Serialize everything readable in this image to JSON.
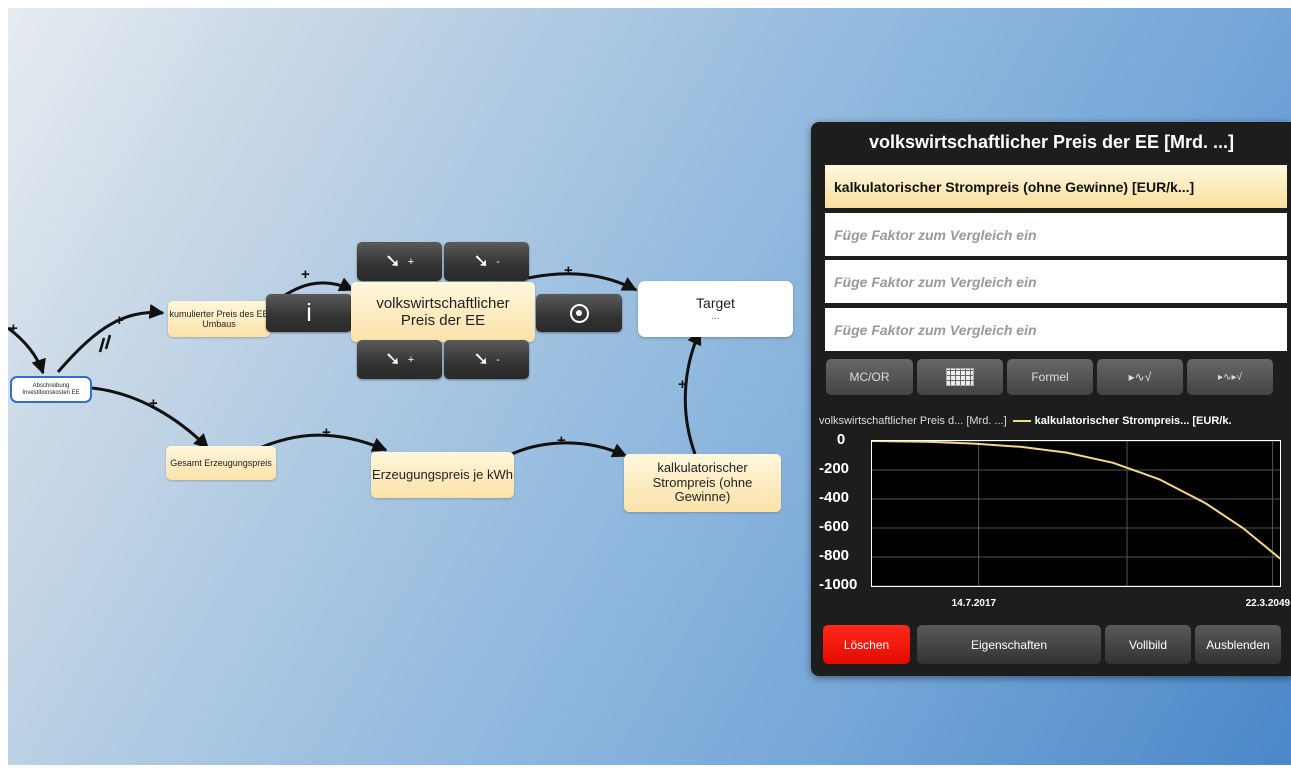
{
  "diagram": {
    "nodes": {
      "abschreibung": "Abschreibung Investitionskosten EE",
      "kumulierter": "kumulierter Preis des EE Umbaus",
      "focus": "volkswirtschaftlicher Preis der EE",
      "target_title": "Target",
      "target_sub": "...",
      "gesamt": "Gesamt Erzeugungspreis",
      "erzeugung": "Erzeugungspreis je kWh",
      "kalk": "kalkulatorischer Strompreis (ohne Gewinne)"
    },
    "focus_buttons": {
      "info": "i",
      "plus": "+",
      "minus": "-"
    },
    "signs": [
      "+",
      "+",
      "+",
      "+",
      "+",
      "+",
      "+",
      "+"
    ]
  },
  "panel": {
    "title": "volkswirtschaftlicher Preis der EE [Mrd. ...]",
    "active_factor": "kalkulatorischer Strompreis (ohne Gewinne) [EUR/k...]",
    "placeholders": [
      "Füge Faktor zum Vergleich ein",
      "Füge Faktor zum Vergleich ein",
      "Füge Faktor zum Vergleich ein"
    ],
    "tools": {
      "mcor": "MC/OR",
      "formel": "Formel"
    },
    "footer": {
      "delete": "Löschen",
      "properties": "Eigenschaften",
      "fullscreen": "Vollbild",
      "hide": "Ausblenden"
    }
  },
  "chart_data": {
    "type": "line",
    "legend": [
      "volkswirtschaftlicher Preis d... [Mrd. ...]",
      "kalkulatorischer Strompreis... [EUR/k."
    ],
    "yticks": [
      "0",
      "-200",
      "-400",
      "-600",
      "-800",
      "-1000"
    ],
    "xticks": [
      "14.7.2017",
      "22.3.2049"
    ],
    "ylim": [
      -1000,
      0
    ],
    "x_span_years": [
      2006,
      2050
    ],
    "grid": true,
    "series": [
      {
        "name": "kalkulatorischer Strompreis... [EUR/k.",
        "color": "#f3d98a",
        "x": [
          2006,
          2012,
          2017,
          2022,
          2027,
          2032,
          2037,
          2042,
          2046,
          2050
        ],
        "y": [
          0,
          -5,
          -18,
          -40,
          -80,
          -150,
          -265,
          -430,
          -600,
          -810
        ]
      }
    ]
  }
}
